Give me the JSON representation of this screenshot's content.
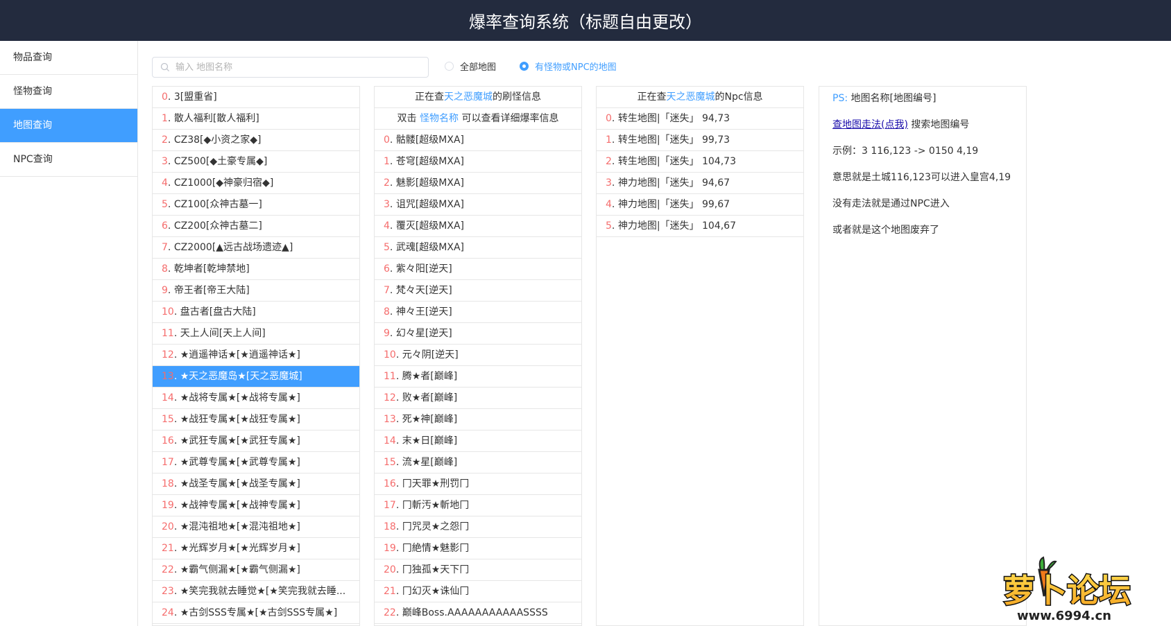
{
  "header": {
    "title": "爆率查询系统（标题自由更改）"
  },
  "sidebar": {
    "items": [
      "物品查询",
      "怪物查询",
      "地图查询",
      "NPC查询"
    ]
  },
  "search": {
    "placeholder": "输入 地图名称"
  },
  "filters": {
    "all": "全部地图",
    "with_monsters": "有怪物或NPC的地图"
  },
  "maps": [
    "3[盟重省]",
    "散人福利[散人福利]",
    "CZ38[◆小资之家◆]",
    "CZ500[◆土豪专属◆]",
    "CZ1000[◆神豪归宿◆]",
    "CZ100[众神古墓一]",
    "CZ200[众神古墓二]",
    "CZ2000[▲远古战场遗迹▲]",
    "乾坤者[乾坤禁地]",
    "帝王者[帝王大陆]",
    "盘古者[盘古大陆]",
    "天上人间[天上人间]",
    "★逍遥神话★[★逍遥神话★]",
    "★天之恶魔岛★[天之恶魔城]",
    "★战将专属★[★战将专属★]",
    "★战狂专属★[★战狂专属★]",
    "★武狂专属★[★武狂专属★]",
    "★武尊专属★[★武尊专属★]",
    "★战圣专属★[★战圣专属★]",
    "★战神专属★[★战神专属★]",
    "★混沌祖地★[★混沌祖地★]",
    "★光辉岁月★[★光辉岁月★]",
    "★霸气侧漏★[★霸气侧漏★]",
    "★笑完我就去睡觉★[★笑完我就去睡...",
    "★古剑SSS专属★[★古剑SSS专属★]"
  ],
  "monster_panel": {
    "prefix": "正在查",
    "map_name": "天之恶魔城",
    "suffix": "的刷怪信息",
    "hint_before": "双击 ",
    "hint_link": "怪物名称",
    "hint_after": " 可以查看详细爆率信息"
  },
  "monsters": [
    "骷髅[超级MXA]",
    "苍穹[超级MXA]",
    "魅影[超级MXA]",
    "诅咒[超级MXA]",
    "覆灭[超级MXA]",
    "武魂[超级MXA]",
    "紫々阳[逆天]",
    "梵々天[逆天]",
    "神々王[逆天]",
    "幻々星[逆天]",
    "元々阴[逆天]",
    "腾★者[巅峰]",
    "败★者[巅峰]",
    "死★神[巅峰]",
    "末★日[巅峰]",
    "流★星[巅峰]",
    "冂天罪★刑罚冂",
    "冂斬汚★斬地冂",
    "冂咒灵★之怨冂",
    "冂絶情★魅影冂",
    "冂独孤★天下冂",
    "冂幻灭★诛仙冂",
    "巅峰Boss.AAAAAAAAAAASSSS"
  ],
  "npc_panel": {
    "prefix": "正在查",
    "map_name": "天之恶魔城",
    "suffix": "的Npc信息"
  },
  "npcs": [
    "转生地图|「迷失」 94,73",
    "转生地图|「迷失」 99,73",
    "转生地图|「迷失」 104,73",
    "神力地图|「迷失」 94,67",
    "神力地图|「迷失」 99,67",
    "神力地图|「迷失」 104,67"
  ],
  "ps": {
    "label": "PS:",
    "format": " 地图名称[地图编号]",
    "link": "查地图走法(点我)",
    "link_after": " 搜索地图编号",
    "example": "示例：3 116,123 -> 0150 4,19",
    "meaning": "意思就是土城116,123可以进入皇宫4,19",
    "no_route": "没有走法就是通过NPC进入",
    "abandoned": "或者就是这个地图废弃了"
  },
  "watermark": {
    "text": "萝卜论坛",
    "url": "www.6994.cn"
  },
  "colors": {
    "accent": "#409eff",
    "index": "#f56c6c",
    "header_bg": "#232b3e"
  },
  "selected_map_index": 13
}
